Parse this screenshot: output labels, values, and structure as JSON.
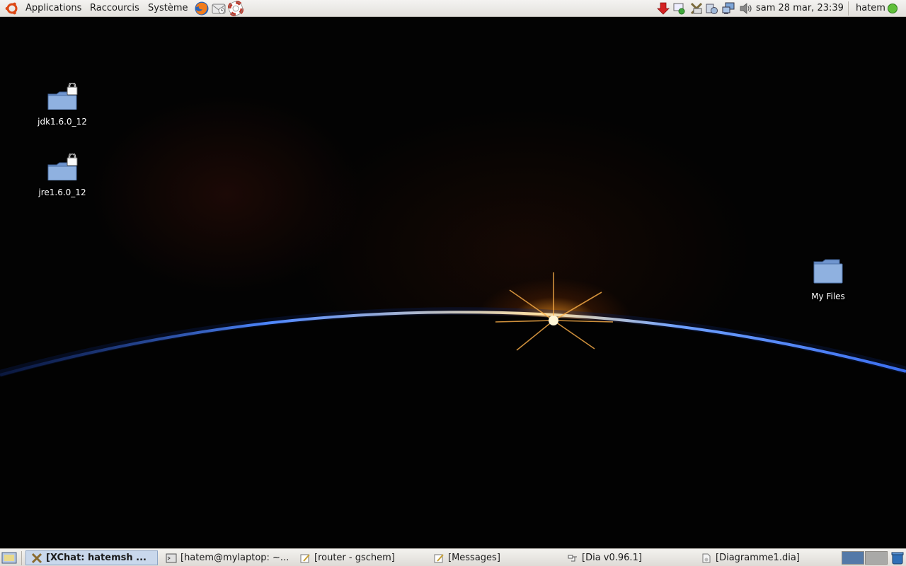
{
  "top_panel": {
    "menus": [
      "Applications",
      "Raccourcis",
      "Système"
    ],
    "launchers": [
      "firefox-icon",
      "mail-icon",
      "help-icon"
    ],
    "tray_icons": [
      "update-notifier-icon",
      "chat-status-icon",
      "xchat-tray-icon",
      "settings-tray-icon",
      "network-icon",
      "volume-icon"
    ],
    "clock": "sam 28 mar, 23:39",
    "user": "hatem"
  },
  "desktop": {
    "icons": [
      {
        "label": "jdk1.6.0_12",
        "icon": "locked-folder-icon"
      },
      {
        "label": "jre1.6.0_12",
        "icon": "locked-folder-icon"
      },
      {
        "label": "My Files",
        "icon": "folder-icon"
      }
    ]
  },
  "taskbar": {
    "tasks": [
      {
        "label": "[XChat: hatemsh ...",
        "icon": "xchat-icon",
        "active": true
      },
      {
        "label": "[hatem@mylaptop: ~...",
        "icon": "terminal-icon",
        "active": false
      },
      {
        "label": "[router - gschem]",
        "icon": "editor-icon",
        "active": false
      },
      {
        "label": "[Messages]",
        "icon": "editor-icon",
        "active": false
      },
      {
        "label": "[Dia v0.96.1]",
        "icon": "dia-icon",
        "active": false
      },
      {
        "label": "[Diagramme1.dia]",
        "icon": "document-icon",
        "active": false
      }
    ],
    "workspaces": [
      {
        "active": true
      },
      {
        "active": false
      }
    ]
  },
  "colors": {
    "panel": "#e8e6e2",
    "active_task": "#c9d8ec",
    "folder": "#8fb1e0",
    "workspace_active": "#5479a8"
  }
}
